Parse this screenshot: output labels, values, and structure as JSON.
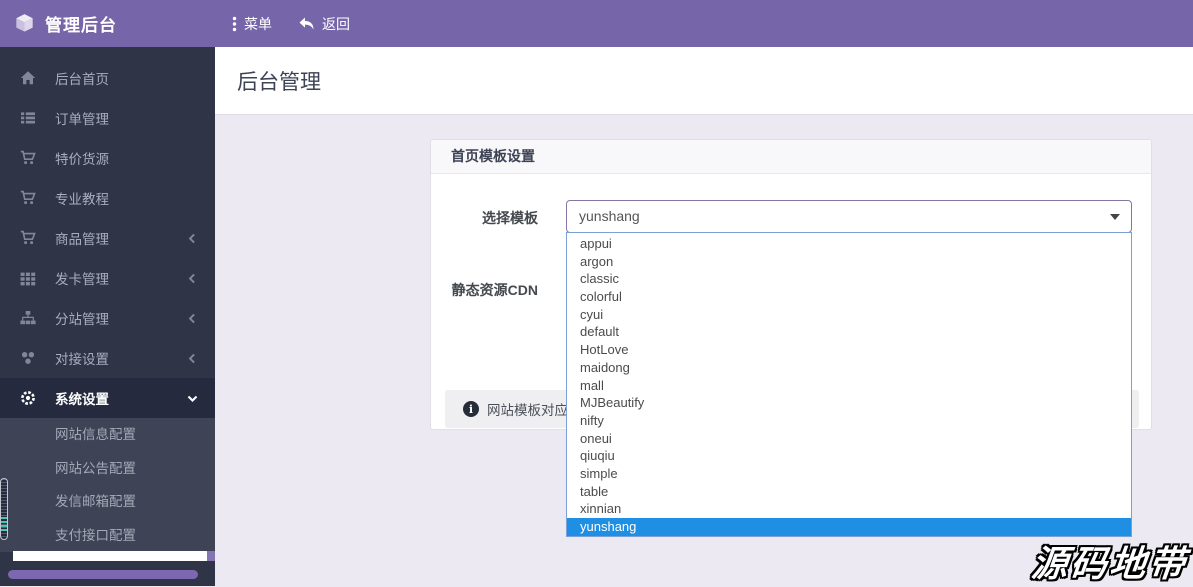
{
  "header": {
    "app_title": "管理后台",
    "menu_label": "菜单",
    "back_label": "返回"
  },
  "sidebar": {
    "items": [
      {
        "label": "后台首页",
        "icon": "home-icon"
      },
      {
        "label": "订单管理",
        "icon": "list-icon"
      },
      {
        "label": "特价货源",
        "icon": "cart-icon"
      },
      {
        "label": "专业教程",
        "icon": "cart-icon"
      },
      {
        "label": "商品管理",
        "icon": "cart-icon",
        "has_submenu": true
      },
      {
        "label": "发卡管理",
        "icon": "grid-icon",
        "has_submenu": true
      },
      {
        "label": "分站管理",
        "icon": "sitemap-icon",
        "has_submenu": true
      },
      {
        "label": "对接设置",
        "icon": "nodes-icon",
        "has_submenu": true
      },
      {
        "label": "系统设置",
        "icon": "gear-icon",
        "has_submenu": true,
        "active": true,
        "expanded": true
      }
    ],
    "submenu": [
      "网站信息配置",
      "网站公告配置",
      "发信邮箱配置",
      "支付接口配置"
    ]
  },
  "main": {
    "page_title": "后台管理",
    "panel": {
      "title": "首页模板设置",
      "field1_label": "选择模板",
      "field2_label": "静态资源CDN",
      "info_alert_text": "网站模板对应"
    },
    "dropdown": {
      "selected": "yunshang",
      "options": [
        "appui",
        "argon",
        "classic",
        "colorful",
        "cyui",
        "default",
        "HotLove",
        "maidong",
        "mall",
        "MJBeautify",
        "nifty",
        "oneui",
        "qiuqiu",
        "simple",
        "table",
        "xinnian",
        "yunshang"
      ]
    }
  },
  "watermark": {
    "text": "源码地带"
  },
  "colors": {
    "topbar": "#7765a9",
    "sidebar": "#2f3447",
    "sidebar_active": "#252a3e",
    "submenu": "#3e4355",
    "content_bg": "#ece9f2",
    "option_selected": "#1e8fe3",
    "select_border": "#85779f",
    "dropdown_border": "#7ba0d6"
  }
}
